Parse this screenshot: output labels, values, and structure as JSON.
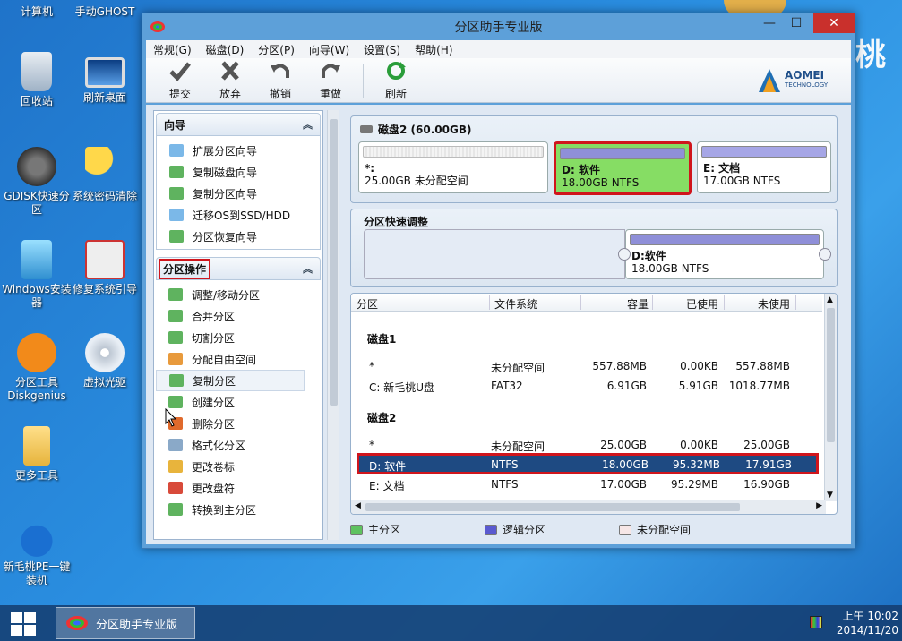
{
  "desktop": {
    "icons": [
      {
        "label": "计算机"
      },
      {
        "label": "手动GHOST"
      },
      {
        "label": "回收站"
      },
      {
        "label": "刷新桌面"
      },
      {
        "label": "GDISK快速分区"
      },
      {
        "label": "系统密码清除"
      },
      {
        "label": "Windows安装器"
      },
      {
        "label": "修复系统引导"
      },
      {
        "label": "分区工具Diskgenius"
      },
      {
        "label": "虚拟光驱"
      },
      {
        "label": "更多工具"
      },
      {
        "label": "新毛桃PE一键装机"
      }
    ],
    "bg_text": "桃"
  },
  "window": {
    "title": "分区助手专业版",
    "minimize": "—",
    "maximize": "☐",
    "close": "✕",
    "menu": [
      "常规(G)",
      "磁盘(D)",
      "分区(P)",
      "向导(W)",
      "设置(S)",
      "帮助(H)"
    ],
    "toolbar": [
      "提交",
      "放弃",
      "撤销",
      "重做",
      "刷新"
    ],
    "logo": {
      "brand": "AOMEI",
      "sub": "TECHNOLOGY"
    }
  },
  "wizard": {
    "title": "向导",
    "items": [
      "扩展分区向导",
      "复制磁盘向导",
      "复制分区向导",
      "迁移OS到SSD/HDD",
      "分区恢复向导"
    ]
  },
  "ops": {
    "title": "分区操作",
    "items": [
      "调整/移动分区",
      "合并分区",
      "切割分区",
      "分配自由空间",
      "复制分区",
      "创建分区",
      "删除分区",
      "格式化分区",
      "更改卷标",
      "更改盘符",
      "转换到主分区"
    ]
  },
  "disk_map": {
    "title": "磁盘2 (60.00GB)",
    "parts": [
      {
        "name": "*:",
        "info": "25.00GB 未分配空间"
      },
      {
        "name": "D: 软件",
        "info": "18.00GB NTFS"
      },
      {
        "name": "E: 文档",
        "info": "17.00GB NTFS"
      }
    ]
  },
  "quick": {
    "title": "分区快速调整",
    "name": "D:软件",
    "info": "18.00GB NTFS"
  },
  "table": {
    "headers": [
      "分区",
      "文件系统",
      "容量",
      "已使用",
      "未使用"
    ],
    "disk1": "磁盘1",
    "disk1_rows": [
      [
        "*",
        "未分配空间",
        "557.88MB",
        "0.00KB",
        "557.88MB"
      ],
      [
        "C: 新毛桃U盘",
        "FAT32",
        "6.91GB",
        "5.91GB",
        "1018.77MB"
      ]
    ],
    "disk2": "磁盘2",
    "disk2_rows": [
      [
        "*",
        "未分配空间",
        "25.00GB",
        "0.00KB",
        "25.00GB"
      ],
      [
        "D: 软件",
        "NTFS",
        "18.00GB",
        "95.32MB",
        "17.91GB"
      ],
      [
        "E: 文档",
        "NTFS",
        "17.00GB",
        "95.29MB",
        "16.90GB"
      ]
    ]
  },
  "legend": [
    "主分区",
    "逻辑分区",
    "未分配空间"
  ],
  "taskbar": {
    "app": "分区助手专业版",
    "time": "上午 10:02",
    "date": "2014/11/20"
  },
  "colors": {
    "selected_row": "#1e4a82",
    "highlight": "#d0151c",
    "green": "#86dd64",
    "primary_bar": "#8f8fd8"
  }
}
